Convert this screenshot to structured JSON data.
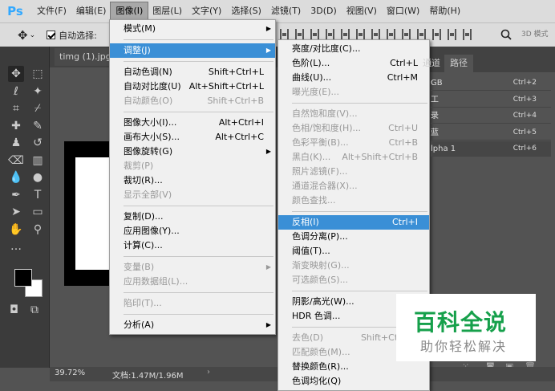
{
  "app": {
    "logo": "Ps"
  },
  "menubar": {
    "items": [
      {
        "label": "文件(F)"
      },
      {
        "label": "编辑(E)"
      },
      {
        "label": "图像(I)"
      },
      {
        "label": "图层(L)"
      },
      {
        "label": "文字(Y)"
      },
      {
        "label": "选择(S)"
      },
      {
        "label": "滤镜(T)"
      },
      {
        "label": "3D(D)"
      },
      {
        "label": "视图(V)"
      },
      {
        "label": "窗口(W)"
      },
      {
        "label": "帮助(H)"
      }
    ],
    "active_index": 2
  },
  "options_bar": {
    "auto_select_label": "自动选择:",
    "mode3d_label": "3D 模式"
  },
  "document": {
    "tab_label": "timg (1).jpg"
  },
  "status": {
    "zoom": "39.72%",
    "doc_size": "文档:1.47M/1.96M"
  },
  "panel": {
    "tabs": [
      "通道",
      "路径"
    ],
    "rows": [
      {
        "name": "GB",
        "shortcut": "Ctrl+2"
      },
      {
        "name": "工",
        "shortcut": "Ctrl+3"
      },
      {
        "name": "录",
        "shortcut": "Ctrl+4"
      },
      {
        "name": "蓝",
        "shortcut": "Ctrl+5"
      },
      {
        "name": "lpha 1",
        "shortcut": "Ctrl+6"
      }
    ]
  },
  "image_menu": {
    "items": [
      {
        "label": "模式(M)",
        "submenu": true
      },
      {
        "sep": true
      },
      {
        "label": "调整(J)",
        "submenu": true,
        "highlight": true
      },
      {
        "sep": true
      },
      {
        "label": "自动色调(N)",
        "shortcut": "Shift+Ctrl+L"
      },
      {
        "label": "自动对比度(U)",
        "shortcut": "Alt+Shift+Ctrl+L"
      },
      {
        "label": "自动颜色(O)",
        "shortcut": "Shift+Ctrl+B",
        "disabled": true
      },
      {
        "sep": true
      },
      {
        "label": "图像大小(I)...",
        "shortcut": "Alt+Ctrl+I"
      },
      {
        "label": "画布大小(S)...",
        "shortcut": "Alt+Ctrl+C"
      },
      {
        "label": "图像旋转(G)",
        "submenu": true
      },
      {
        "label": "裁剪(P)",
        "disabled": true
      },
      {
        "label": "裁切(R)..."
      },
      {
        "label": "显示全部(V)",
        "disabled": true
      },
      {
        "sep": true
      },
      {
        "label": "复制(D)..."
      },
      {
        "label": "应用图像(Y)..."
      },
      {
        "label": "计算(C)..."
      },
      {
        "sep": true
      },
      {
        "label": "变量(B)",
        "submenu": true,
        "disabled": true
      },
      {
        "label": "应用数据组(L)...",
        "disabled": true
      },
      {
        "sep": true
      },
      {
        "label": "陷印(T)...",
        "disabled": true
      },
      {
        "sep": true
      },
      {
        "label": "分析(A)",
        "submenu": true
      }
    ]
  },
  "adjust_menu": {
    "items": [
      {
        "label": "亮度/对比度(C)..."
      },
      {
        "label": "色阶(L)...",
        "shortcut": "Ctrl+L"
      },
      {
        "label": "曲线(U)...",
        "shortcut": "Ctrl+M"
      },
      {
        "label": "曝光度(E)...",
        "disabled": true
      },
      {
        "sep": true
      },
      {
        "label": "自然饱和度(V)...",
        "disabled": true
      },
      {
        "label": "色相/饱和度(H)...",
        "shortcut": "Ctrl+U",
        "disabled": true
      },
      {
        "label": "色彩平衡(B)...",
        "shortcut": "Ctrl+B",
        "disabled": true
      },
      {
        "label": "黑白(K)...",
        "shortcut": "Alt+Shift+Ctrl+B",
        "disabled": true
      },
      {
        "label": "照片滤镜(F)...",
        "disabled": true
      },
      {
        "label": "通道混合器(X)...",
        "disabled": true
      },
      {
        "label": "颜色查找...",
        "disabled": true
      },
      {
        "sep": true
      },
      {
        "label": "反相(I)",
        "shortcut": "Ctrl+I",
        "highlight": true
      },
      {
        "label": "色调分离(P)..."
      },
      {
        "label": "阈值(T)..."
      },
      {
        "label": "渐变映射(G)...",
        "disabled": true
      },
      {
        "label": "可选颜色(S)...",
        "disabled": true
      },
      {
        "sep": true
      },
      {
        "label": "阴影/高光(W)..."
      },
      {
        "label": "HDR 色调..."
      },
      {
        "sep": true
      },
      {
        "label": "去色(D)",
        "shortcut": "Shift+Ctrl+U",
        "disabled": true
      },
      {
        "label": "匹配颜色(M)...",
        "disabled": true
      },
      {
        "label": "替换颜色(R)..."
      },
      {
        "label": "色调均化(Q)"
      }
    ]
  },
  "watermark": {
    "title": "百科全说",
    "subtitle": "助你轻松解决"
  },
  "colors": {
    "accent": "#3a8fd6",
    "brand": "#31a8ff",
    "watermark_green": "#16a04b"
  }
}
